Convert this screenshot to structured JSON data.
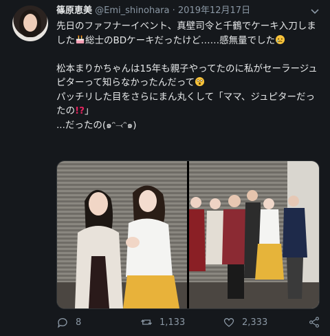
{
  "author": {
    "name": "篠原恵美",
    "handle": "@Emi_shinohara",
    "separator": "·",
    "date": "2019年12月17日"
  },
  "tweet": {
    "line1": "先日のファフナーイベント、真壁司令と千鶴でケーキ入刀しました",
    "line1b": "総士のBDケーキだったけど……感無量でした",
    "line2": "松本まりかちゃんは15年も親子やってたのに私がセーラージュピターって知らなかったんだって",
    "line3": "パッチリした目をさらにまん丸くして「ママ、ジュピターだったの",
    "line3b": "」",
    "line4": "...だったの(๑ᵔ⤙ᵔ๑)"
  },
  "emoji": {
    "cake": "cake-icon",
    "sad_face": "crying-face-icon",
    "surprised_face": "astonished-face-icon",
    "interrobang": "!?"
  },
  "actions": {
    "replies": "8",
    "retweets": "1,133",
    "likes": "2,333"
  },
  "colors": {
    "background": "#15181c",
    "text": "#e7e9ea",
    "muted": "#8b98a5",
    "interrobang": "#e0245e"
  }
}
